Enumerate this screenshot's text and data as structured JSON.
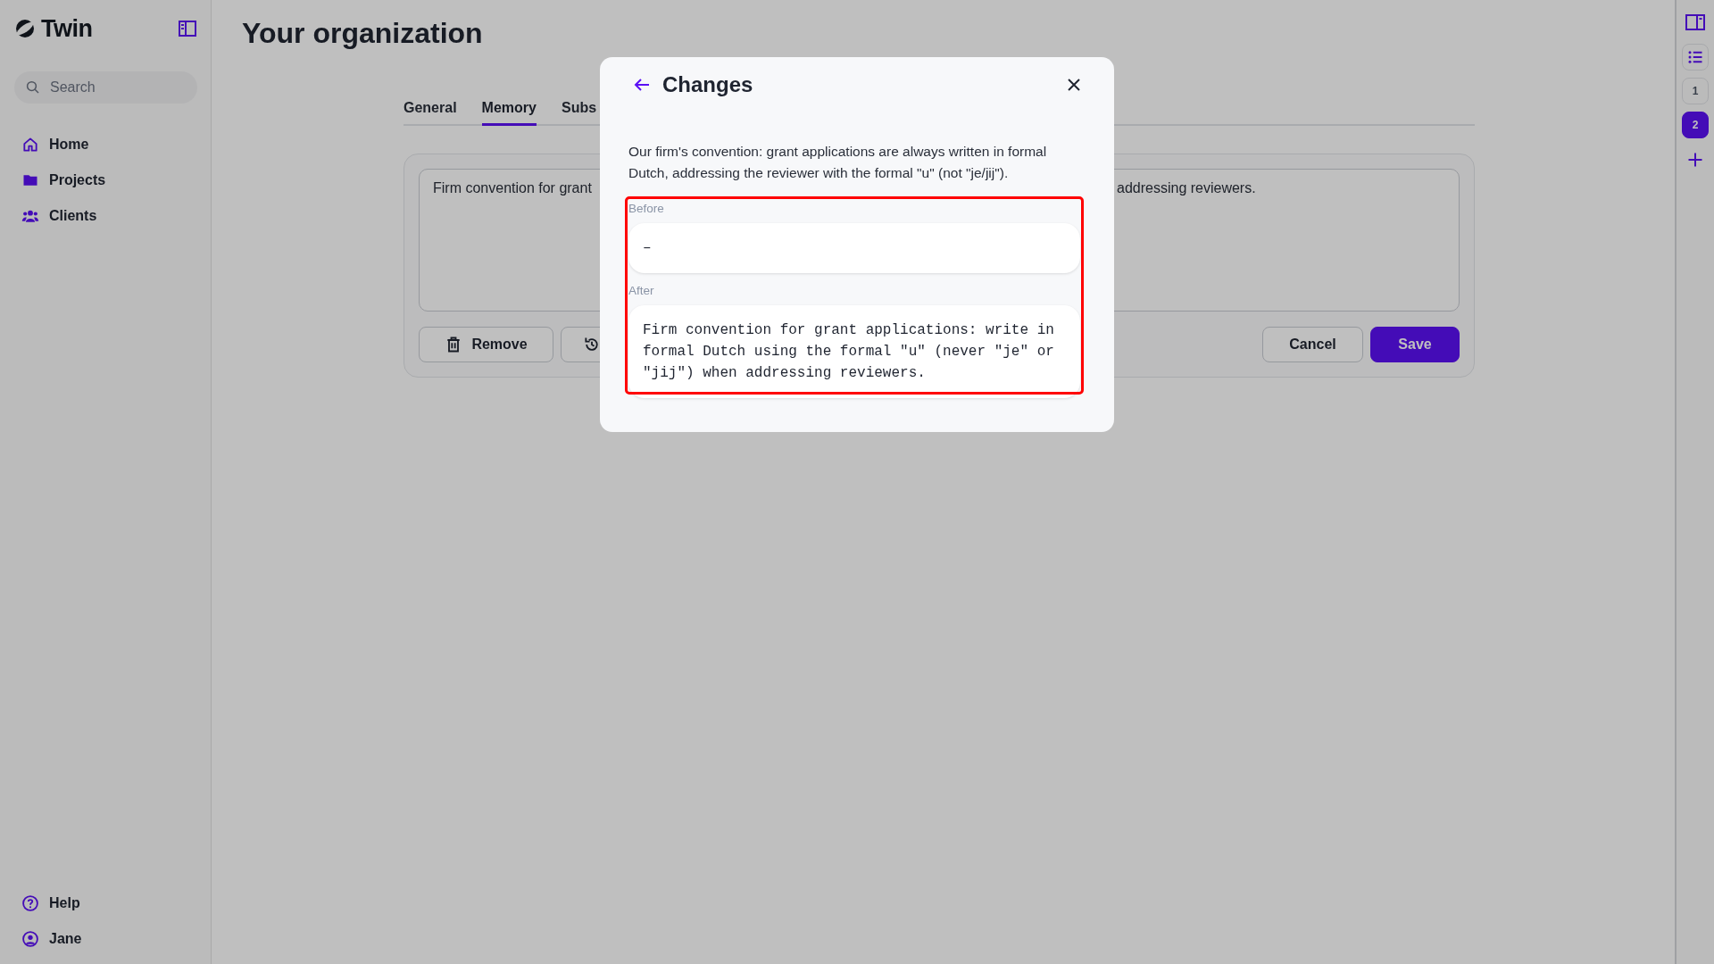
{
  "sidebar": {
    "logo": "Twin",
    "search": {
      "placeholder": "Search"
    },
    "nav": [
      {
        "label": "Home",
        "kind": "home"
      },
      {
        "label": "Projects",
        "kind": "folder"
      },
      {
        "label": "Clients",
        "kind": "users"
      }
    ],
    "footer": [
      {
        "label": "Help",
        "kind": "help"
      },
      {
        "label": "Jane",
        "kind": "user"
      }
    ]
  },
  "page": {
    "title": "Your organization",
    "tabs": [
      {
        "label": "General",
        "selected": false
      },
      {
        "label": "Memory",
        "selected": true
      },
      {
        "label": "Subs",
        "selected": false
      }
    ],
    "memory": {
      "text_start": "Firm convention for grant",
      "text_end": "addressing reviewers.",
      "buttons": [
        {
          "kind": "remove",
          "label": "Remove"
        },
        {
          "kind": "restore"
        }
      ],
      "actions": [
        {
          "kind": "secondary",
          "label": "Cancel"
        },
        {
          "kind": "primary",
          "label": "Save"
        }
      ]
    }
  },
  "right_rail": {
    "pages": [
      {
        "label": "1",
        "selected": false
      },
      {
        "label": "2",
        "selected": true
      }
    ]
  },
  "dialog": {
    "title": "Changes",
    "description": "Our firm's convention: grant applications are always written in formal Dutch, addressing the reviewer with the formal \"u\" (not \"je/jij\").",
    "highlighted": true,
    "sections": [
      {
        "label": "Before",
        "value": "–"
      },
      {
        "label": "After",
        "value": "Firm convention for grant applications: write in formal Dutch using the formal \"u\" (never \"je\" or \"jij\") when addressing reviewers."
      }
    ]
  }
}
